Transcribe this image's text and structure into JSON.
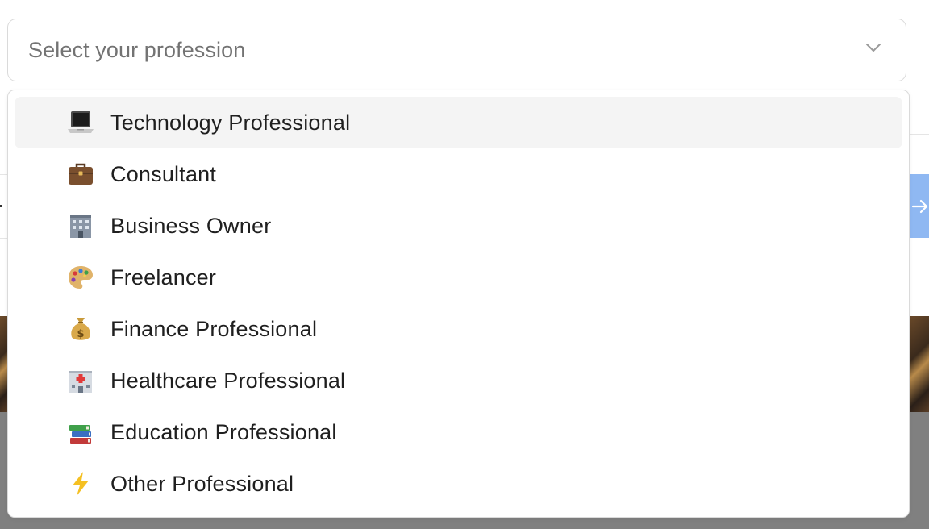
{
  "select": {
    "placeholder": "Select your profession"
  },
  "options": [
    {
      "icon": "laptop-icon",
      "label": "Technology Professional",
      "highlighted": true
    },
    {
      "icon": "briefcase-icon",
      "label": "Consultant"
    },
    {
      "icon": "office-building-icon",
      "label": "Business Owner"
    },
    {
      "icon": "artist-palette-icon",
      "label": "Freelancer"
    },
    {
      "icon": "money-bag-icon",
      "label": "Finance Professional"
    },
    {
      "icon": "hospital-icon",
      "label": "Healthcare Professional"
    },
    {
      "icon": "books-icon",
      "label": "Education Professional"
    },
    {
      "icon": "lightning-icon",
      "label": "Other Professional"
    }
  ],
  "colors": {
    "highlight": "#f4f4f4",
    "border": "#dadada",
    "placeholder_text": "#737373",
    "option_text": "#1f1f1f",
    "background_overlay": "#808080",
    "background_button": "#8fb8f2"
  }
}
